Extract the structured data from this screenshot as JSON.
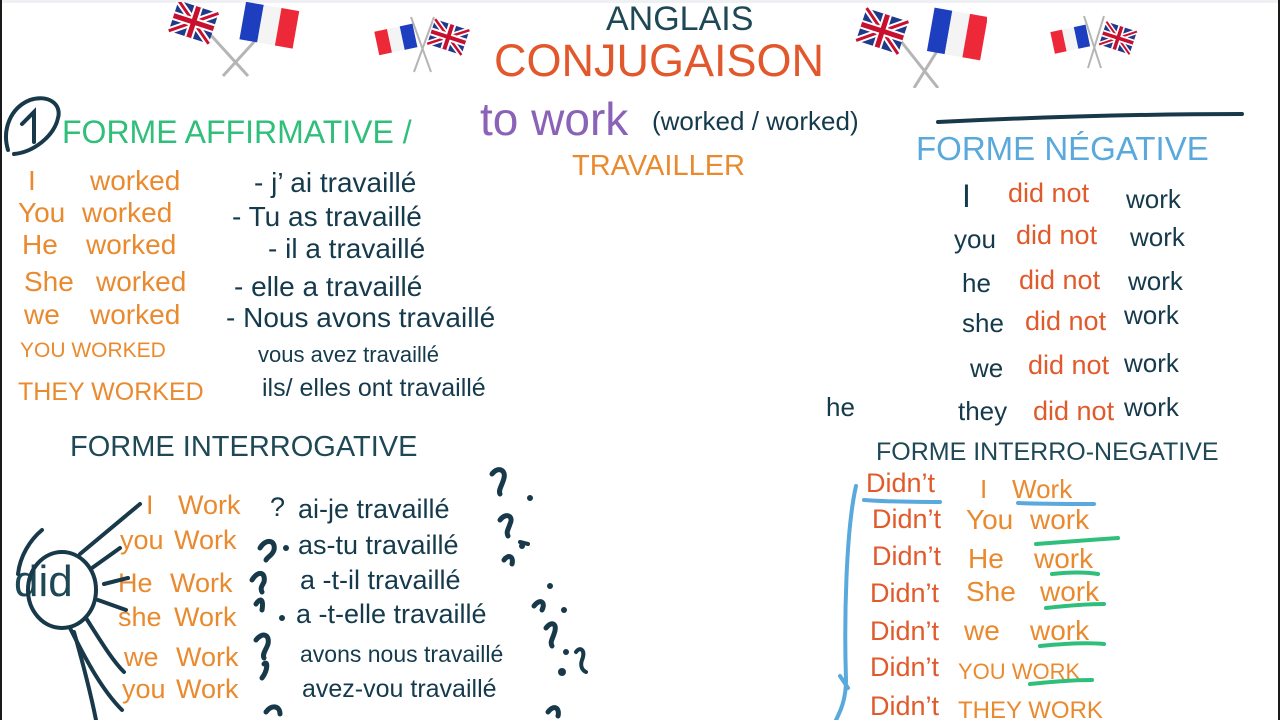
{
  "header": {
    "title_top": "ANGLAIS",
    "title_main": "CONJUGAISON",
    "flags": [
      "uk-france-crossed-flags-icon",
      "france-uk-crossed-flags-icon",
      "uk-france-crossed-flags-icon",
      "france-uk-crossed-flags-icon"
    ]
  },
  "verb": {
    "infinitive": "to work",
    "forms": "(worked / worked)",
    "translation": "TRAVAILLER"
  },
  "colors": {
    "orange": "#ea8a2f",
    "red": "#e05a2b",
    "navy": "#143a4c",
    "green": "#2fbf7a",
    "blue": "#5aa9dd",
    "purple": "#8a63b9"
  },
  "affirmative": {
    "number_mark": "1",
    "heading": "FORME AFFIRMATIVE /",
    "rows": [
      {
        "subject": "I",
        "verb": "worked",
        "french": "- j’  ai  travaillé"
      },
      {
        "subject": "You",
        "verb": "worked",
        "french": "- Tu  as travaillé"
      },
      {
        "subject": "He",
        "verb": "worked",
        "french": "- il  a travaillé"
      },
      {
        "subject": "She",
        "verb": "worked",
        "french": "- elle a travaillé"
      },
      {
        "subject": "we",
        "verb": "worked",
        "french": "- Nous  avons travaillé"
      },
      {
        "subject": "YOU WORKED",
        "verb": "",
        "french": "vous avez travaillé"
      },
      {
        "subject": "THEY WORKED",
        "verb": "",
        "french": "ils/ elles ont travaillé"
      }
    ]
  },
  "negative": {
    "heading": "FORME NÉGATIVE",
    "rows": [
      {
        "subject": "I",
        "aux": "did not",
        "verb": "work"
      },
      {
        "subject": "you",
        "aux": "did not",
        "verb": "work"
      },
      {
        "subject": "he",
        "aux": "did not",
        "verb": "work"
      },
      {
        "subject": "she",
        "aux": "did not",
        "verb": "work"
      },
      {
        "subject": "we",
        "aux": "did not",
        "verb": "work"
      },
      {
        "subject": "they",
        "aux": "did not",
        "verb": "work"
      }
    ],
    "stray_text": "he"
  },
  "interrogative": {
    "heading": "FORME INTERROGATIVE",
    "aux_circled": "did",
    "rows": [
      {
        "subject": "I",
        "verb": "Work",
        "mark": "?",
        "french": "ai-je travaillé"
      },
      {
        "subject": "you",
        "verb": "Work",
        "mark": "",
        "french": "as-tu travaillé"
      },
      {
        "subject": "He",
        "verb": "Work",
        "mark": "",
        "french": "a -t-il travaillé"
      },
      {
        "subject": "she",
        "verb": "Work",
        "mark": "",
        "french": "a -t-elle travaillé"
      },
      {
        "subject": "we",
        "verb": "Work",
        "mark": "",
        "french": "avons nous travaillé"
      },
      {
        "subject": "you",
        "verb": "Work",
        "mark": "",
        "french": "avez-vou travaillé"
      }
    ]
  },
  "interro_negative": {
    "heading": "FORME INTERRO-NEGATIVE",
    "rows": [
      {
        "aux": "Didn’t",
        "subject": "I",
        "verb": "Work"
      },
      {
        "aux": "Didn’t",
        "subject": "You",
        "verb": "work"
      },
      {
        "aux": "Didn’t",
        "subject": "He",
        "verb": "work"
      },
      {
        "aux": "Didn’t",
        "subject": "She",
        "verb": "work"
      },
      {
        "aux": "Didn’t",
        "subject": "we",
        "verb": "work"
      },
      {
        "aux": "Didn’t",
        "subject": "YOU WORK",
        "verb": ""
      },
      {
        "aux": "Didn’t",
        "subject": "THEY WORK",
        "verb": ""
      }
    ]
  }
}
